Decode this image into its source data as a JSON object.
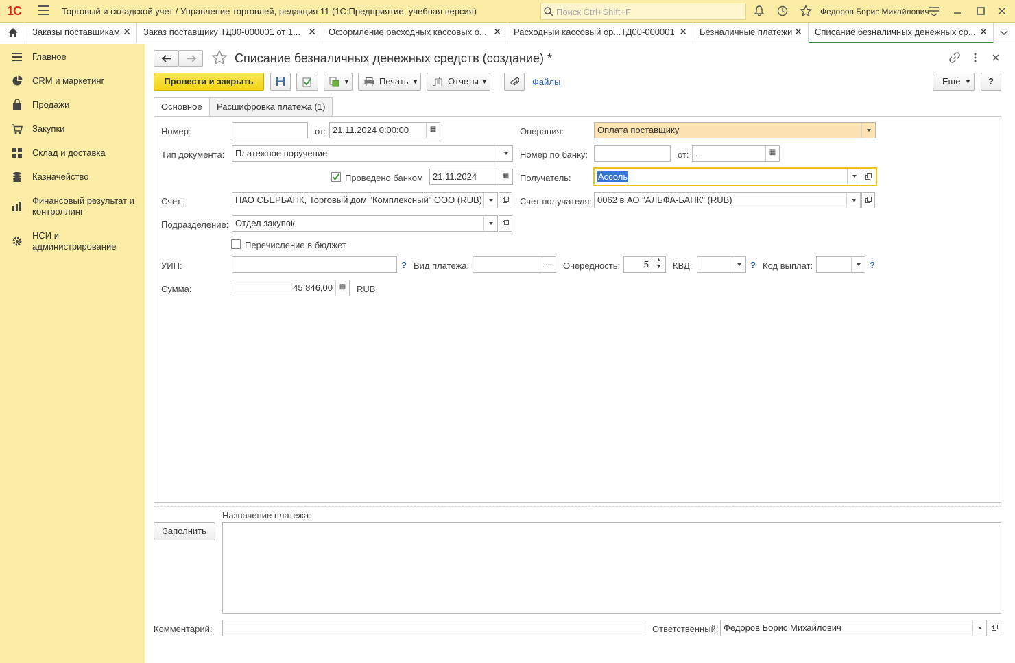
{
  "app": {
    "logo": "1С",
    "title": "Торговый и складской учет / Управление торговлей, редакция 11  (1С:Предприятие, учебная версия)",
    "search_placeholder": "Поиск Ctrl+Shift+F",
    "user": "Федоров Борис Михайлович"
  },
  "tabs": [
    {
      "label": "Заказы поставщикам"
    },
    {
      "label": "Заказ поставщику ТД00-000001 от 1..."
    },
    {
      "label": "Оформление расходных кассовых о..."
    },
    {
      "label": "Расходный кассовый ор...ТД00-000001"
    },
    {
      "label": "Безналичные платежи"
    },
    {
      "label": "Списание безналичных денежных ср..."
    }
  ],
  "sidebar": {
    "items": [
      {
        "label": "Главное",
        "icon": "menu-lines-icon"
      },
      {
        "label": "CRM и маркетинг",
        "icon": "pie-chart-icon"
      },
      {
        "label": "Продажи",
        "icon": "shopping-bag-icon"
      },
      {
        "label": "Закупки",
        "icon": "cart-icon"
      },
      {
        "label": "Склад и доставка",
        "icon": "grid-icon"
      },
      {
        "label": "Казначейство",
        "icon": "coins-icon"
      },
      {
        "label": "Финансовый результат и контроллинг",
        "icon": "bar-chart-icon"
      },
      {
        "label": "НСИ и администрирование",
        "icon": "gear-icon"
      }
    ]
  },
  "document": {
    "title": "Списание безналичных денежных средств (создание) *"
  },
  "toolbar": {
    "post_close": "Провести и закрыть",
    "print": "Печать",
    "reports": "Отчеты",
    "files": "Файлы",
    "more": "Еще",
    "help": "?"
  },
  "form_tabs": {
    "main": "Основное",
    "details": "Расшифровка платежа (1)"
  },
  "form": {
    "number_label": "Номер:",
    "number_value": "",
    "from_label": "от:",
    "date_value": "21.11.2024  0:00:00",
    "operation_label": "Операция:",
    "operation_value": "Оплата поставщику",
    "doc_type_label": "Тип документа:",
    "doc_type_value": "Платежное поручение",
    "bank_number_label": "Номер по банку:",
    "bank_number_value": "",
    "bank_from_label": "от:",
    "bank_date_value": " .  .",
    "posted_by_bank_label": "Проведено банком",
    "posted_by_bank_date": "21.11.2024",
    "recipient_label": "Получатель:",
    "recipient_value": "Ассоль",
    "account_label": "Счет:",
    "account_value": "ПАО СБЕРБАНК, Торговый дом \"Комплексный\" ООО (RUB)",
    "recipient_account_label": "Счет получателя:",
    "recipient_account_value": "0062 в АО \"АЛЬФА-БАНК\" (RUB)",
    "division_label": "Подразделение:",
    "division_value": "Отдел закупок",
    "budget_transfer_label": "Перечисление в бюджет",
    "uip_label": "УИП:",
    "uip_value": "",
    "payment_kind_label": "Вид платежа:",
    "payment_kind_value": "",
    "priority_label": "Очередность:",
    "priority_value": "5",
    "kvd_label": "КВД:",
    "kvd_value": "",
    "payout_code_label": "Код выплат:",
    "payout_code_value": "",
    "amount_label": "Сумма:",
    "amount_value": "45 846,00",
    "currency": "RUB",
    "purpose_label": "Назначение платежа:",
    "purpose_value": "",
    "fill_button": "Заполнить",
    "comment_label": "Комментарий:",
    "comment_value": "",
    "responsible_label": "Ответственный:",
    "responsible_value": "Федоров Борис Михайлович"
  },
  "colors": {
    "sidebar_bg": "#fbeda6",
    "primary_button": "#f2d516",
    "highlight_field": "#fce3b4",
    "focus_border": "#f0c419",
    "link": "#1f5aa6"
  }
}
